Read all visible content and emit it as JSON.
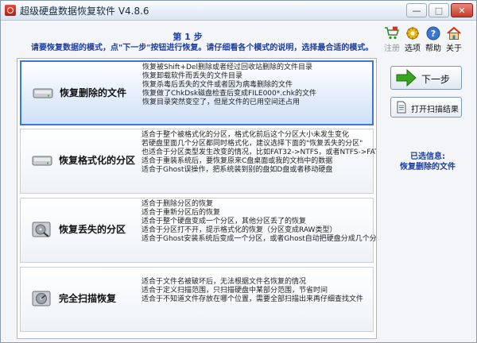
{
  "window": {
    "title": "超级硬盘数据恢复软件 V4.8.6",
    "controls": {
      "minimize": "—",
      "maximize": "□",
      "close": "✕"
    }
  },
  "header": {
    "step_title": "第 1 步",
    "instructions": "请要恢复数据的模式，点\"下一步\"按钮进行恢复。请仔细看各个模式的说明，选择最合适的模式。"
  },
  "toolbar": [
    {
      "label": "注册",
      "icon": "cart-icon",
      "disabled": true
    },
    {
      "label": "选项",
      "icon": "gear-icon",
      "disabled": false
    },
    {
      "label": "帮助",
      "icon": "help-icon",
      "disabled": false
    },
    {
      "label": "关于",
      "icon": "home-icon",
      "disabled": false
    }
  ],
  "modes": [
    {
      "label": "恢复删除的文件",
      "icon": "hard-drive-icon",
      "selected": true,
      "lines": [
        "恢复被Shift+Del删除或者经过回收站删除的文件目录",
        "恢复卸载软件而丢失的文件目录",
        "恢复杀毒后丢失的文件或者因为病毒删除的文件",
        "恢复做了ChkDsk磁盘检查后变成FILE000*.chk的文件",
        "恢复目录突然变空了，但是文件的已用空间还占用"
      ]
    },
    {
      "label": "恢复格式化的分区",
      "icon": "hard-drive-icon",
      "selected": false,
      "lines": [
        "适合于整个被格式化的分区，格式化前后这个分区大小未发生变化",
        "若硬盘里面几个分区都同时格式化，建议选择下面的\"恢复丢失的分区\"",
        "也适合于分区类型发生改变的情况，比如FAT32->NTFS，或者NTFS->FAT3",
        "适合于重装系统后，要恢复原来C盘桌面或我的文档中的数据",
        "适合于Ghost误操作，把系统装到别的盘如D盘或者移动硬盘"
      ]
    },
    {
      "label": "恢复丢失的分区",
      "icon": "disk-search-icon",
      "selected": false,
      "lines": [
        "适合于删除分区的恢复",
        "适合于重新分区后的恢复",
        "适合于整个硬盘变成一个分区，其他分区丢了的恢复",
        "适合于分区打不开，提示格式化的恢复（分区变成RAW类型）",
        "适合于Ghost安装系统后变成一个分区，或者Ghost自动把硬盘分成几个分"
      ]
    },
    {
      "label": "完全扫描恢复",
      "icon": "disk-scan-icon",
      "selected": false,
      "lines": [
        "",
        "适合于文件名被破坏后，无法根据文件名恢复的情况",
        "适合于定义扫描范围，只扫描硬盘中某部分范围，节省时间",
        "适合于不知道文件存放在哪个位置，需要全部扫描出来再仔细查找文件",
        ""
      ]
    }
  ],
  "sidebar": {
    "next_label": "下一步",
    "open_scan_label": "打开扫描结果",
    "selected_caption": "已选信息:",
    "selected_value": "恢复删除的文件"
  },
  "colors": {
    "accent_blue": "#1e3f9e",
    "selected_border": "#3a78d8",
    "next_arrow_green": "#3aa51f"
  }
}
